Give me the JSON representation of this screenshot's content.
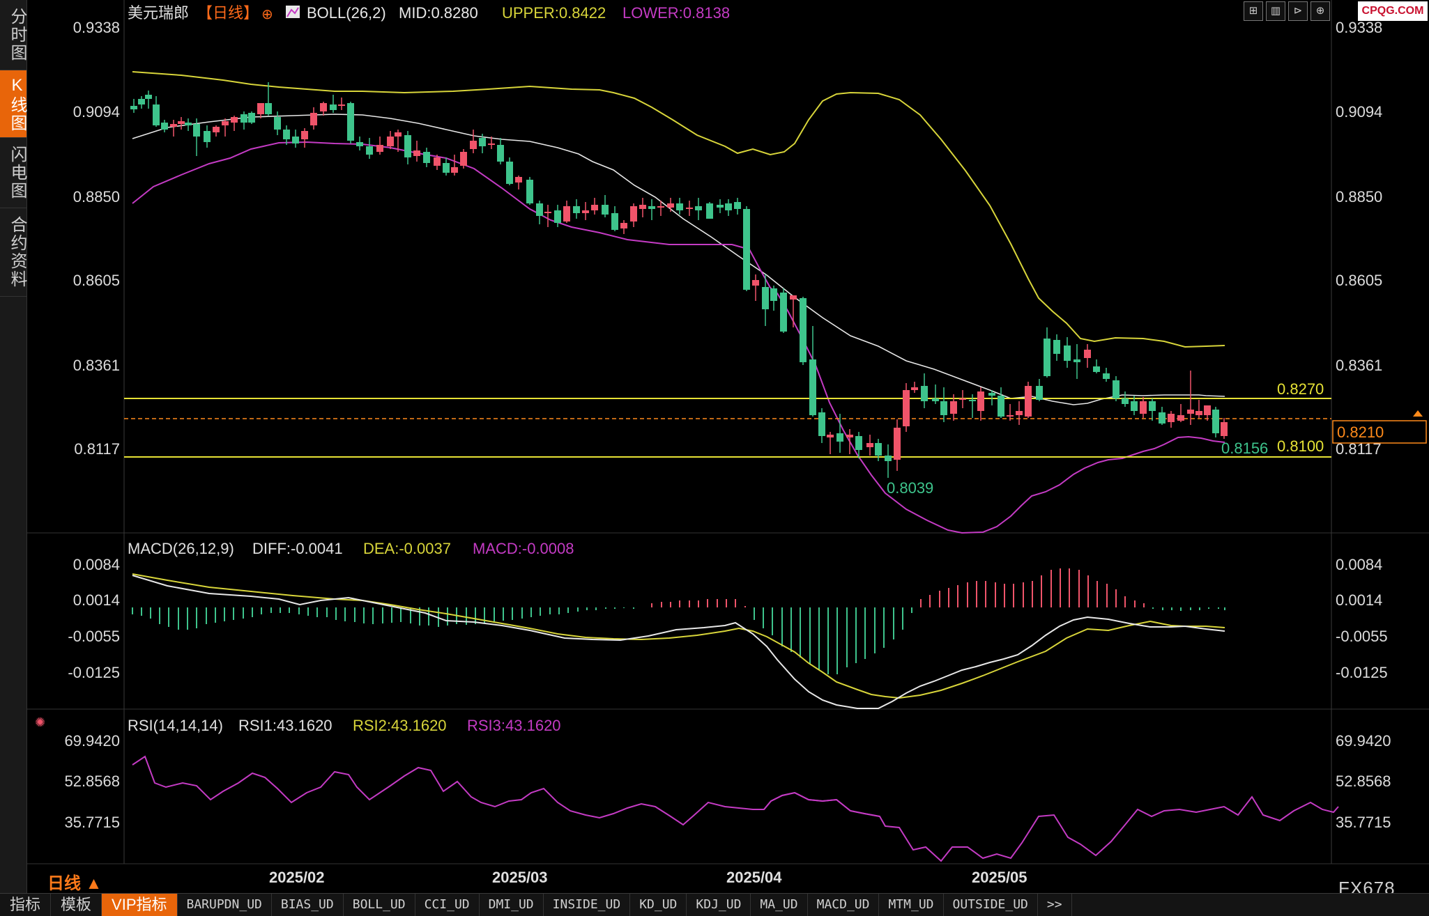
{
  "sidebar": {
    "tabs": [
      {
        "label": "分时图",
        "active": false
      },
      {
        "label": "K线图",
        "active": true
      },
      {
        "label": "闪电图",
        "active": false
      },
      {
        "label": "合约资料",
        "active": false
      }
    ]
  },
  "header": {
    "symbol": "美元瑞郎",
    "period": "【日线】",
    "boll_label": "BOLL(26,2)",
    "mid": "MID:0.8280",
    "upper": "UPPER:0.8422",
    "lower": "LOWER:0.8138"
  },
  "toolbar": {
    "icons": [
      "crosshair-icon",
      "bar-chart-icon",
      "step-forward-icon",
      "zoom-in-icon"
    ]
  },
  "logo_text": "CPQG.COM",
  "price_axis": {
    "ticks": [
      "0.9338",
      "0.9094",
      "0.8850",
      "0.8605",
      "0.8361",
      "0.8117"
    ]
  },
  "annotations": {
    "line_upper": "0.8270",
    "line_lower": "0.8100",
    "current_price": "0.8210",
    "low_label": "0.8039",
    "lower_band_label": "0.8156"
  },
  "macd": {
    "label": "MACD(26,12,9)",
    "diff": "DIFF:-0.0041",
    "dea": "DEA:-0.0037",
    "macd": "MACD:-0.0008",
    "ticks": [
      "0.0084",
      "0.0014",
      "-0.0055",
      "-0.0125"
    ]
  },
  "rsi": {
    "label": "RSI(14,14,14)",
    "rsi1": "RSI1:43.1620",
    "rsi2": "RSI2:43.1620",
    "rsi3": "RSI3:43.1620",
    "ticks": [
      "69.9420",
      "52.8568",
      "35.7715"
    ]
  },
  "x_axis": {
    "months": [
      "2025/02",
      "2025/03",
      "2025/04",
      "2025/05"
    ]
  },
  "period_label": "日线 ▲",
  "bottom_tabs": [
    {
      "label": "指标",
      "cn": true,
      "active": false
    },
    {
      "label": "模板",
      "cn": true,
      "active": false
    },
    {
      "label": "VIP指标",
      "cn": true,
      "active": true
    },
    {
      "label": "BARUPDN_UD",
      "active": false
    },
    {
      "label": "BIAS_UD",
      "active": false
    },
    {
      "label": "BOLL_UD",
      "active": false
    },
    {
      "label": "CCI_UD",
      "active": false
    },
    {
      "label": "DMI_UD",
      "active": false
    },
    {
      "label": "INSIDE_UD",
      "active": false
    },
    {
      "label": "KD_UD",
      "active": false
    },
    {
      "label": "KDJ_UD",
      "active": false
    },
    {
      "label": "MA_UD",
      "active": false
    },
    {
      "label": "MACD_UD",
      "active": false
    },
    {
      "label": "MTM_UD",
      "active": false
    },
    {
      "label": "OUTSIDE_UD",
      "active": false
    },
    {
      "label": ">>",
      "active": false
    }
  ],
  "brand": "FX678",
  "colors": {
    "up": "#f0546a",
    "down": "#3ec48c",
    "upper": "#d8d53a",
    "mid": "#e8e8e8",
    "lower": "#c43bc4",
    "accent": "#e8650a"
  }
}
